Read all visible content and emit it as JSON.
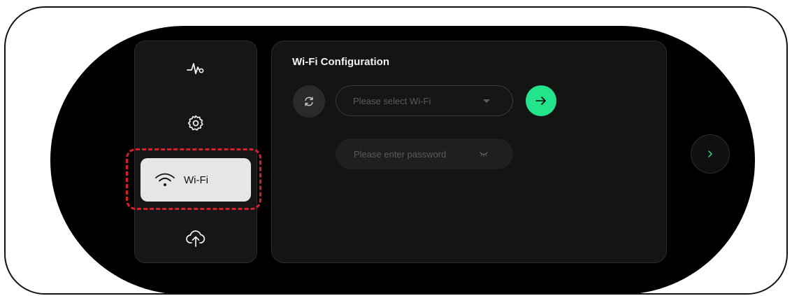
{
  "sidebar": {
    "items": [
      {
        "id": "monitor",
        "icon": "activity-pulse-icon"
      },
      {
        "id": "settings",
        "icon": "gear-icon"
      },
      {
        "id": "wifi",
        "icon": "wifi-icon",
        "label": "Wi-Fi",
        "active": true
      },
      {
        "id": "upload",
        "icon": "cloud-upload-icon"
      }
    ]
  },
  "panel": {
    "title": "Wi-Fi Configuration",
    "wifi_select": {
      "placeholder": "Please select Wi-Fi",
      "value": ""
    },
    "password": {
      "placeholder": "Please enter password",
      "value": ""
    }
  },
  "colors": {
    "accent": "#23e38b",
    "highlight": "#d61f2c",
    "background": "#000000",
    "panel": "#141414",
    "active_tab": "#e6e6e6"
  }
}
